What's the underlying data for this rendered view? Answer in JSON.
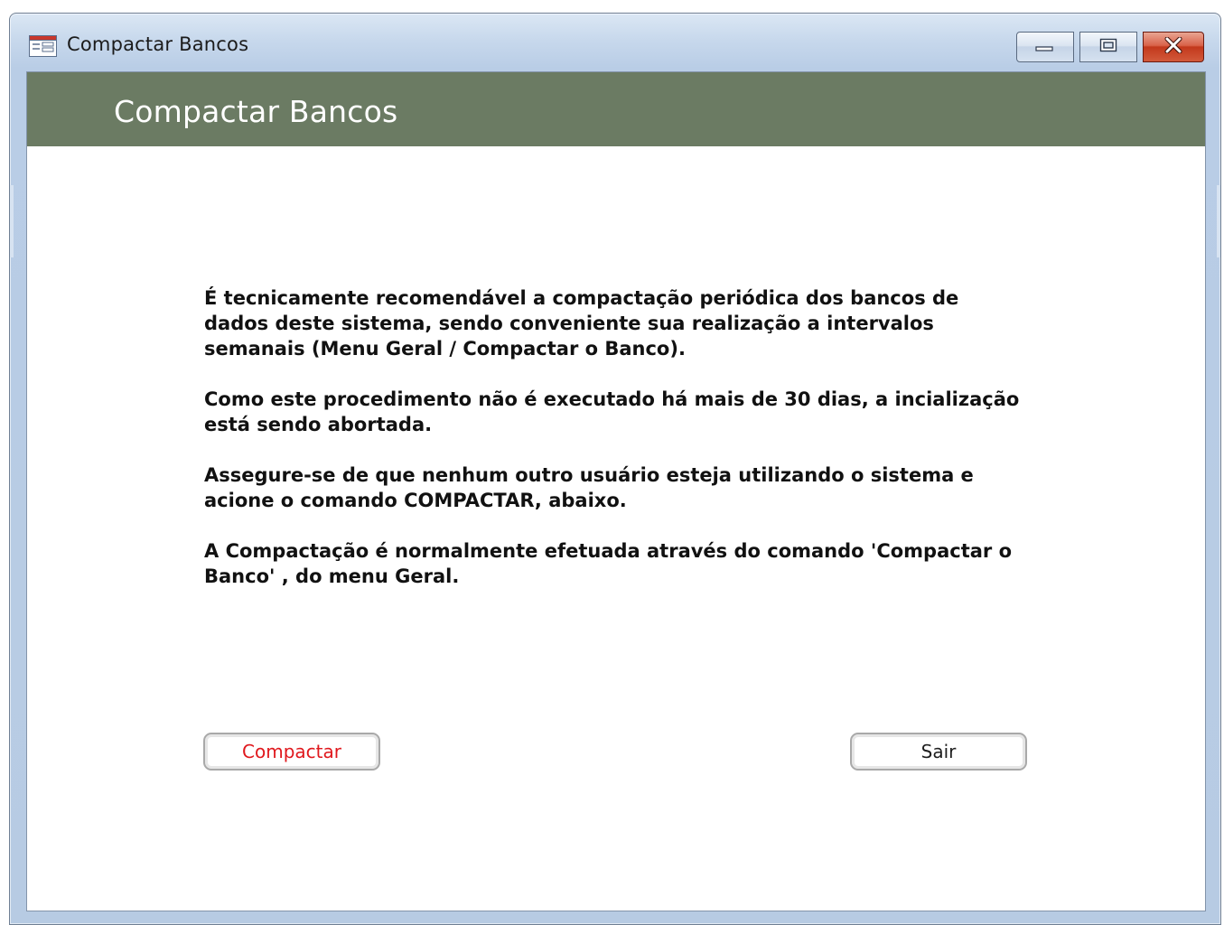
{
  "window": {
    "title": "Compactar Bancos",
    "controls": {
      "minimize": "minimize",
      "maximize": "maximize",
      "close": "close"
    }
  },
  "form": {
    "header_title": "Compactar Bancos",
    "header_color": "#6b7b63",
    "paragraphs": [
      "É tecnicamente recomendável a compactação periódica dos bancos de dados deste sistema, sendo conveniente sua realização a intervalos semanais (Menu Geral / Compactar o Banco).",
      "Como este procedimento não é executado há mais de 30 dias, a incialização está sendo abortada.",
      "Assegure-se de que nenhum outro usuário esteja utilizando o sistema e acione o comando COMPACTAR, abaixo.",
      "A Compactação é normalmente efetuada através do comando 'Compactar o Banco' , do menu Geral."
    ],
    "buttons": {
      "compactar": "Compactar",
      "sair": "Sair"
    },
    "compactar_color": "#e0181d"
  },
  "icons": {
    "app": "form-icon",
    "minimize": "minimize-icon",
    "maximize": "maximize-icon",
    "close": "close-icon"
  }
}
